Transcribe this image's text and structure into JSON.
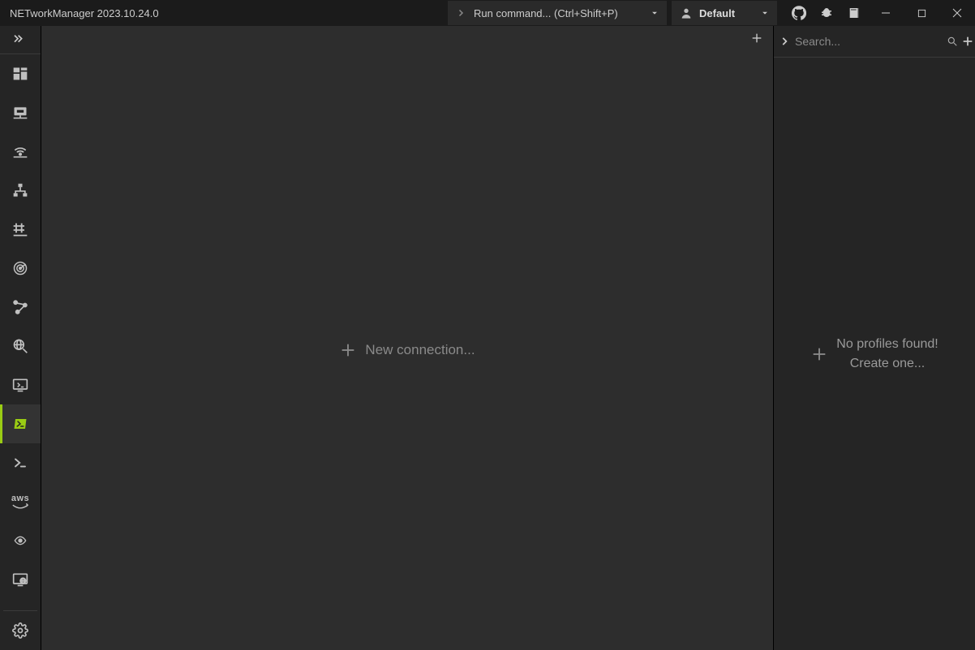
{
  "app": {
    "title": "NETworkManager 2023.10.24.0",
    "run_command_placeholder": "Run command... (Ctrl+Shift+P)",
    "profile_selected": "Default"
  },
  "sidebar": {
    "items": [
      {
        "name": "dashboard",
        "active": false
      },
      {
        "name": "network-interface",
        "active": false
      },
      {
        "name": "wifi",
        "active": false
      },
      {
        "name": "ip-scanner",
        "active": false
      },
      {
        "name": "port-scanner",
        "active": false
      },
      {
        "name": "ping-monitor",
        "active": false
      },
      {
        "name": "traceroute",
        "active": false
      },
      {
        "name": "dns-lookup",
        "active": false
      },
      {
        "name": "remote-desktop",
        "active": false
      },
      {
        "name": "powershell",
        "active": true
      },
      {
        "name": "putty",
        "active": false
      },
      {
        "name": "aws-session-manager",
        "active": false
      },
      {
        "name": "tigervnc",
        "active": false
      },
      {
        "name": "web-console",
        "active": false
      }
    ]
  },
  "main": {
    "new_connection_label": "New connection..."
  },
  "right": {
    "search_placeholder": "Search...",
    "no_profiles_line1": "No profiles found!",
    "no_profiles_line2": "Create one..."
  },
  "icons": {
    "aws_label": "aws"
  }
}
